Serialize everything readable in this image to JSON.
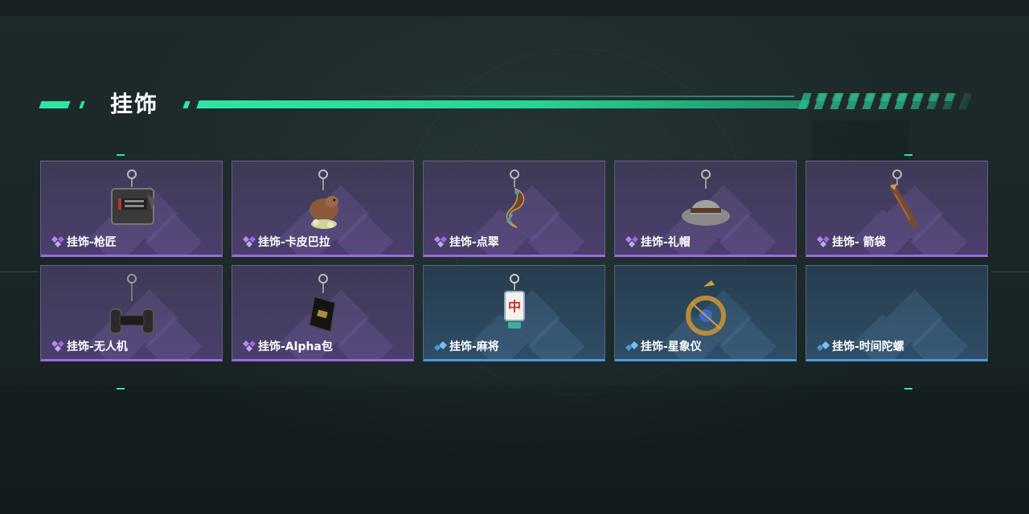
{
  "section": {
    "title": "挂饰"
  },
  "colors": {
    "accent": "#2ee6a0",
    "rare_purple": "#9b6ae0",
    "rare_blue": "#4a9ae0"
  },
  "cards": [
    {
      "label": "挂饰-枪匠",
      "rarity": "purple",
      "icon": "gun-parts-charm-icon"
    },
    {
      "label": "挂饰-卡皮巴拉",
      "rarity": "purple",
      "icon": "capybara-charm-icon"
    },
    {
      "label": "挂饰-点翠",
      "rarity": "purple",
      "icon": "phoenix-charm-icon"
    },
    {
      "label": "挂饰-礼帽",
      "rarity": "purple",
      "icon": "hat-charm-icon"
    },
    {
      "label": "挂饰- 箭袋",
      "rarity": "purple",
      "icon": "quiver-charm-icon"
    },
    {
      "label": "挂饰-无人机",
      "rarity": "purple",
      "icon": "drone-charm-icon"
    },
    {
      "label": "挂饰-Alpha包",
      "rarity": "purple",
      "icon": "alpha-bag-charm-icon"
    },
    {
      "label": "挂饰-麻将",
      "rarity": "blue",
      "icon": "mahjong-charm-icon"
    },
    {
      "label": "挂饰-星象仪",
      "rarity": "blue",
      "icon": "astrolabe-charm-icon"
    },
    {
      "label": "挂饰-时间陀螺",
      "rarity": "blue",
      "icon": "time-top-charm-icon"
    }
  ]
}
